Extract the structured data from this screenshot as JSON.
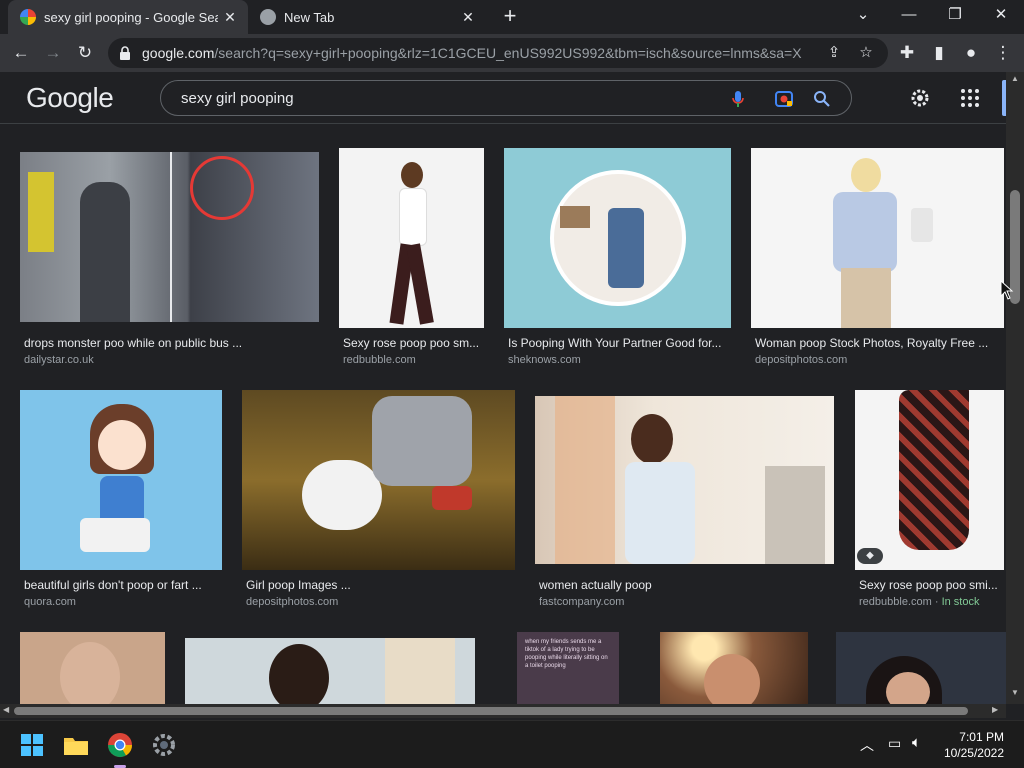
{
  "browser": {
    "tabs": [
      {
        "title": "sexy girl pooping - Google Search",
        "active": true
      },
      {
        "title": "New Tab",
        "active": false
      }
    ],
    "address": {
      "host": "google.com",
      "path": "/search?q=sexy+girl+pooping&rlz=1C1GCEU_enUS992US992&tbm=isch&source=lnms&sa=X..."
    }
  },
  "google": {
    "logo": "Google",
    "query": "sexy girl pooping"
  },
  "results": [
    {
      "caption": "drops monster poo while on public bus ...",
      "source": "dailystar.co.uk"
    },
    {
      "caption": "Sexy rose poop poo sm...",
      "source": "redbubble.com"
    },
    {
      "caption": "Is Pooping With Your Partner Good for...",
      "source": "sheknows.com"
    },
    {
      "caption": "Woman poop Stock Photos, Royalty Free ...",
      "source": "depositphotos.com"
    },
    {
      "caption": "beautiful girls don't poop or fart ...",
      "source": "quora.com"
    },
    {
      "caption": "Girl poop Images ...",
      "source": "depositphotos.com"
    },
    {
      "caption": "women actually poop",
      "source": "fastcompany.com"
    },
    {
      "caption": "Sexy rose poop poo smi...",
      "source": "redbubble.com",
      "badge": "In stock"
    }
  ],
  "partial_image_text": "when my friends sends me a tiktok of a lady trying to be pooping while literally sitting on a toilet pooping",
  "taskbar": {
    "time": "7:01 PM",
    "date": "10/25/2022"
  },
  "colors": {
    "page_bg": "#202124",
    "toolbar_bg": "#35363a",
    "link_blue": "#8ab4f8",
    "stock_green": "#81c995"
  }
}
